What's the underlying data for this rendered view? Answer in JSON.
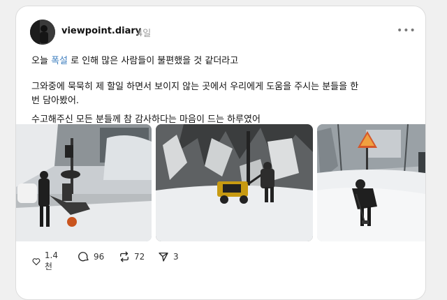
{
  "post": {
    "username": "viewpoint.diary",
    "time": "4일",
    "more_label": "•••",
    "text_line1_before": "오늘",
    "hashtag": "폭설",
    "text_line1_after": "로 인해 많은 사람들이 불편했을 것 같더라고",
    "text_line2": "그와중에 묵묵히 제 할일 하면서 보이지 않는 곳에서 우리에게 도움을 주시는 분들을 한",
    "text_line3": "번 담아봤어.",
    "text_line4": "수고해주신 모든 분들께 참 감사하다는 마음이 드는 하루였어"
  },
  "actions": {
    "likes": "1.4천",
    "comments": "96",
    "reposts": "72",
    "shares": "3"
  },
  "icons": [
    "heart-icon",
    "comment-icon",
    "repost-icon",
    "share-icon",
    "more-icon"
  ]
}
